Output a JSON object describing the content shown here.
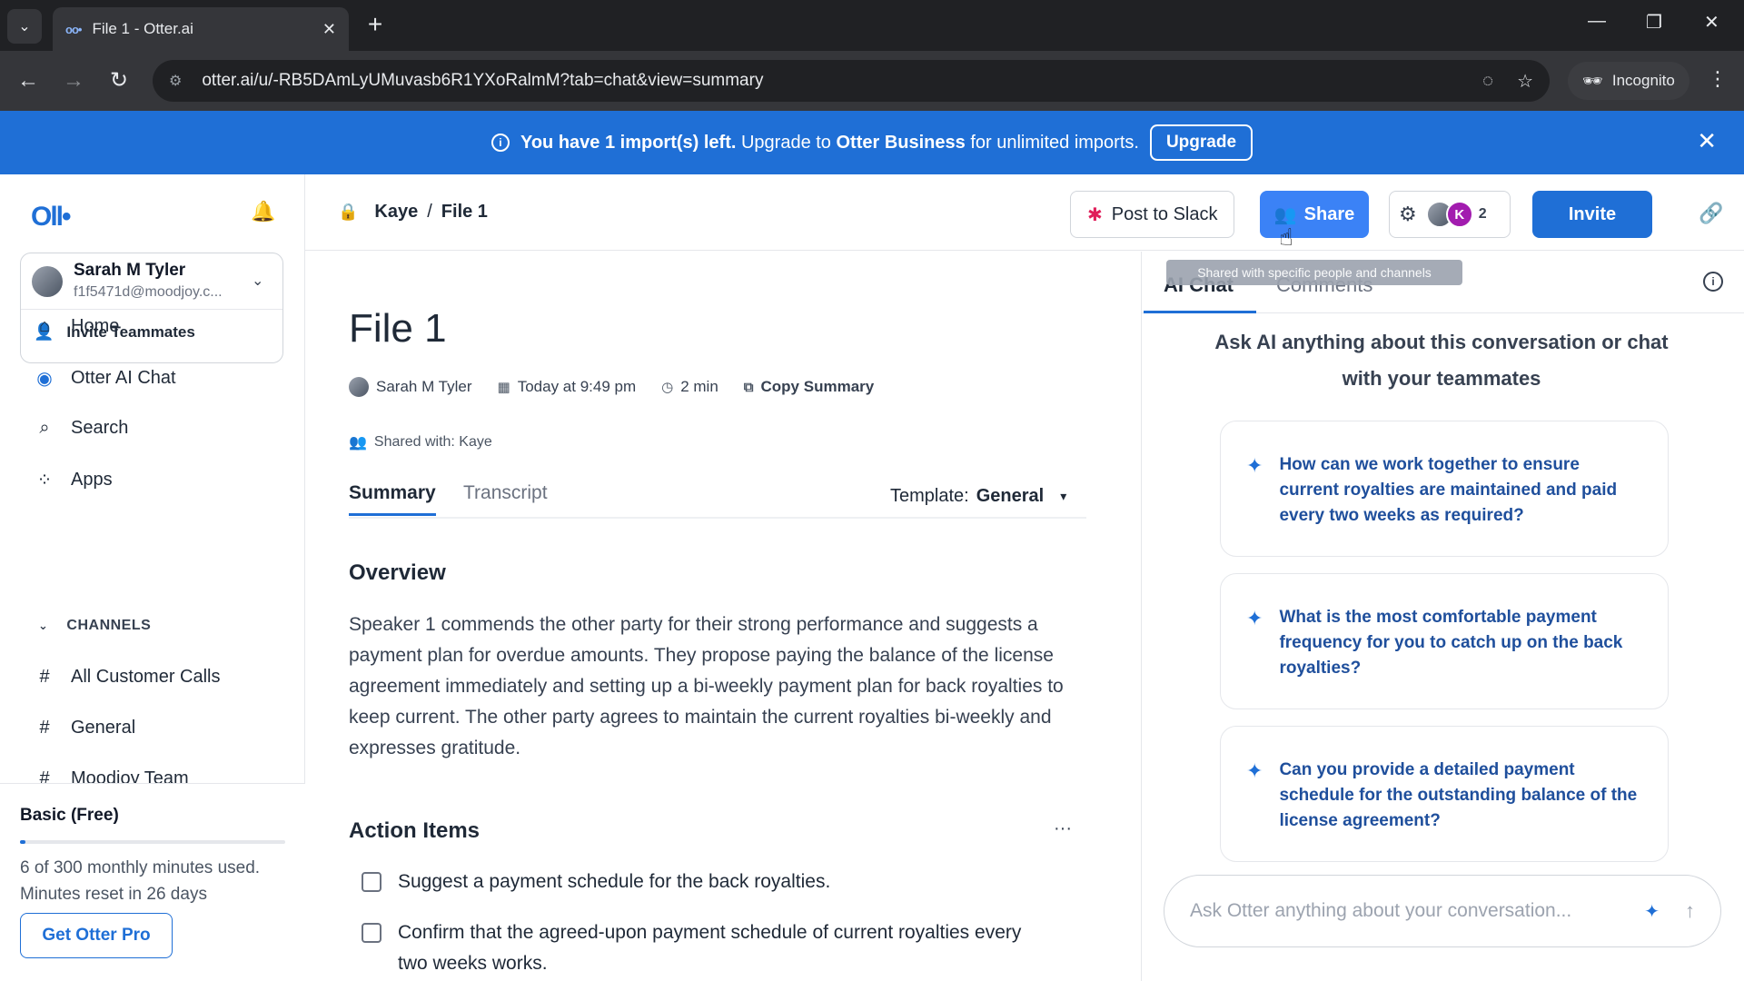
{
  "browser": {
    "tab_title": "File 1 - Otter.ai",
    "url": "otter.ai/u/-RB5DAmLyUMuvasb6R1YXoRalmM?tab=chat&view=summary",
    "incognito_label": "Incognito"
  },
  "banner": {
    "text_bold": "You have 1 import(s) left.",
    "text_mid": " Upgrade to ",
    "text_brand": "Otter Business",
    "text_end": " for unlimited imports.",
    "button_label": "Upgrade"
  },
  "sidebar": {
    "logo_text": "Oll•",
    "user": {
      "name": "Sarah M Tyler",
      "email": "f1f5471d@moodjoy.c..."
    },
    "invite_label": "Invite Teammates",
    "nav": [
      {
        "label": "Home",
        "icon": "home-icon"
      },
      {
        "label": "Otter AI Chat",
        "icon": "otter-chat-icon"
      },
      {
        "label": "Search",
        "icon": "search-icon"
      },
      {
        "label": "Apps",
        "icon": "apps-icon"
      }
    ],
    "channels_heading": "CHANNELS",
    "channels": [
      "All Customer Calls",
      "General",
      "Moodjoy Team"
    ],
    "plan": {
      "title": "Basic (Free)",
      "usage_line1": "6 of 300 monthly minutes used.",
      "usage_line2": "Minutes reset in 26 days",
      "usage_fraction": 0.02,
      "button_label": "Get Otter Pro"
    }
  },
  "header": {
    "breadcrumb_owner": "Kaye",
    "breadcrumb_sep": "/",
    "breadcrumb_file": "File 1",
    "post_slack_label": "Post to Slack",
    "share_label": "Share",
    "member_initial": "K",
    "member_count": "2",
    "invite_label": "Invite",
    "share_tooltip": "Shared with specific people and channels"
  },
  "document": {
    "title": "File 1",
    "author": "Sarah M Tyler",
    "date": "Today at 9:49 pm",
    "duration": "2 min",
    "copy_summary": "Copy Summary",
    "shared_with": "Shared with: Kaye",
    "tabs": {
      "summary": "Summary",
      "transcript": "Transcript"
    },
    "template_label": "Template:",
    "template_value": "General",
    "overview_heading": "Overview",
    "overview_text": "Speaker 1 commends the other party for their strong performance and suggests a payment plan for overdue amounts. They propose paying the balance of the license agreement immediately and setting up a bi-weekly payment plan for back royalties to keep current. The other party agrees to maintain the current royalties bi-weekly and expresses gratitude.",
    "actions_heading": "Action Items",
    "action_items": [
      "Suggest a payment schedule for the back royalties.",
      "Confirm that the agreed-upon payment schedule of current royalties every two weeks works."
    ]
  },
  "ai_panel": {
    "tab_chat": "AI Chat",
    "tab_comments": "Comments",
    "intro": "Ask AI anything about this conversation or chat with your teammates",
    "suggestions": [
      "How can we work together to ensure current royalties are maintained and paid every two weeks as required?",
      "What is the most comfortable payment frequency for you to catch up on the back royalties?",
      "Can you provide a detailed payment schedule for the outstanding balance of the license agreement?"
    ],
    "input_placeholder": "Ask Otter anything about your conversation..."
  },
  "colors": {
    "brand_blue": "#1f6fd6",
    "banner_blue": "#1f6fd6",
    "share_blue": "#3b82f6"
  }
}
